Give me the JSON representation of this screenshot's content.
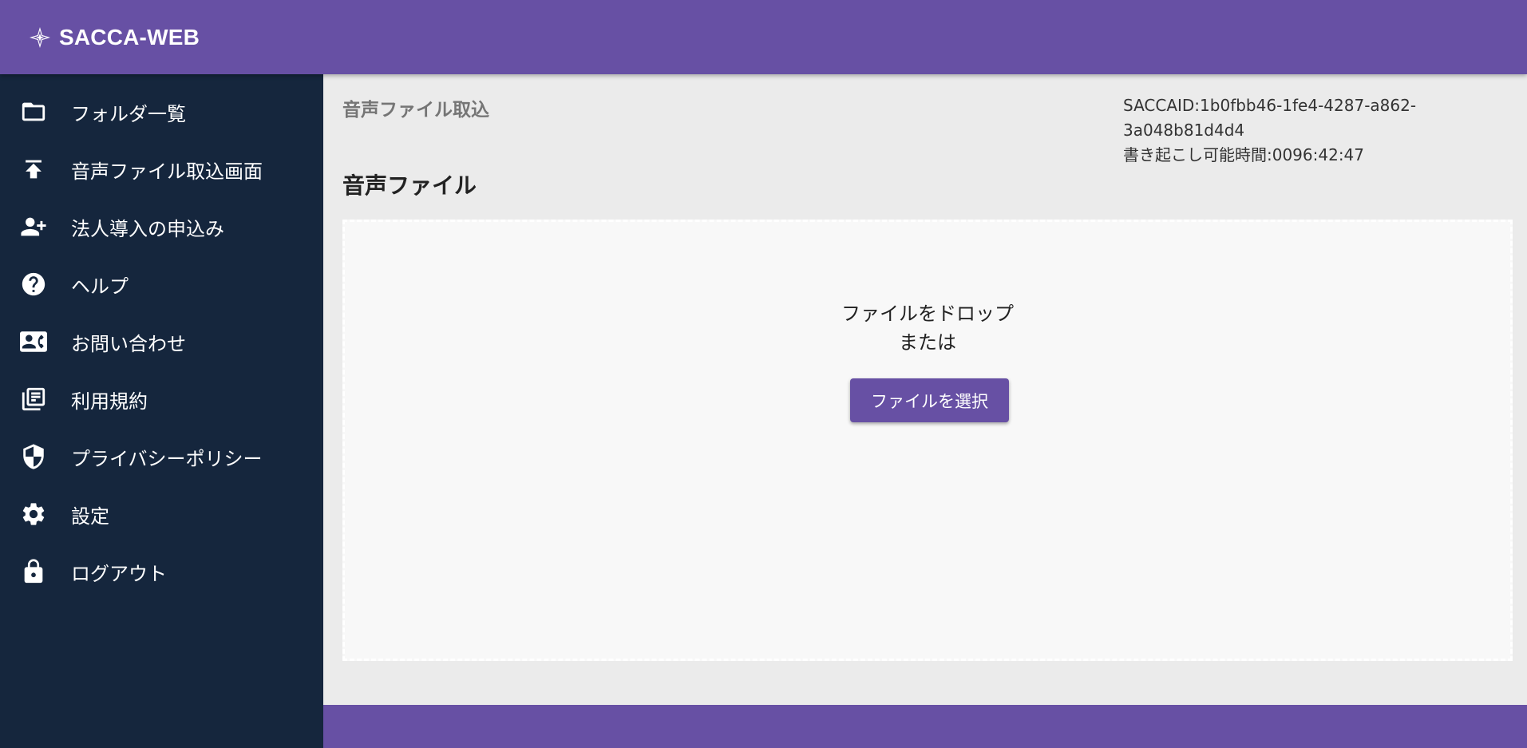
{
  "app": {
    "title": "SACCA-WEB"
  },
  "sidebar": {
    "items": [
      {
        "label": "フォルダ一覧",
        "icon": "folder-icon"
      },
      {
        "label": "音声ファイル取込画面",
        "icon": "upload-icon"
      },
      {
        "label": "法人導入の申込み",
        "icon": "person-add-icon"
      },
      {
        "label": "ヘルプ",
        "icon": "help-icon"
      },
      {
        "label": "お問い合わせ",
        "icon": "contact-icon"
      },
      {
        "label": "利用規約",
        "icon": "terms-icon"
      },
      {
        "label": "プライバシーポリシー",
        "icon": "shield-icon"
      },
      {
        "label": "設定",
        "icon": "gear-icon"
      },
      {
        "label": "ログアウト",
        "icon": "lock-icon"
      }
    ]
  },
  "main": {
    "heading": "音声ファイル取込",
    "account": {
      "sacca_id_line1": "SACCAID:1b0fbb46-1fe4-4287-a862-",
      "sacca_id_line2": "3a048b81d4d4",
      "remaining_time": "書き起こし可能時間:0096:42:47"
    },
    "section_title": "音声ファイル",
    "dropzone": {
      "drop_text": "ファイルをドロップ",
      "or_text": "または",
      "button_label": "ファイルを選択"
    }
  },
  "colors": {
    "header": "#6750a4",
    "sidebar": "#15263d",
    "background": "#ebebeb",
    "dropzone": "#f8f8f8",
    "button": "#6750a4"
  }
}
